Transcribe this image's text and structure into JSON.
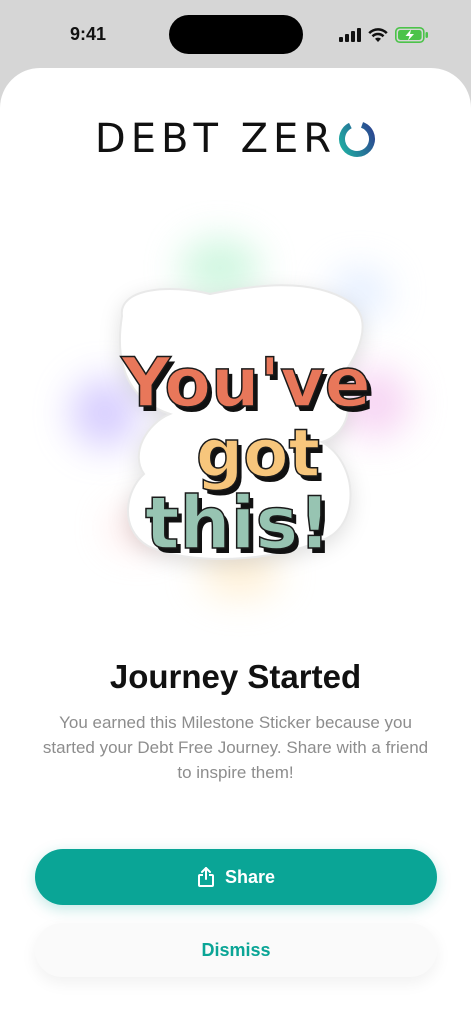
{
  "status_bar": {
    "time": "9:41",
    "icons": [
      "signal-icon",
      "wifi-icon",
      "battery-charging-icon"
    ]
  },
  "brand": {
    "logo_text": "DEBT ZER",
    "logo_ring_colors": [
      "#1f9e95",
      "#2c3f8f"
    ]
  },
  "sticker": {
    "line1": "You've",
    "line2": "got",
    "line3": "this!",
    "colors": {
      "line1": "#e8775a",
      "line2": "#f7c67c",
      "line3": "#97c4b2"
    }
  },
  "milestone": {
    "title": "Journey Started",
    "description": "You earned this Milestone Sticker because you started your Debt Free Journey. Share with a friend to inspire them!"
  },
  "actions": {
    "share_label": "Share",
    "dismiss_label": "Dismiss"
  },
  "colors": {
    "accent": "#0aa596",
    "text": "#111111",
    "muted": "#8d8d8d"
  }
}
